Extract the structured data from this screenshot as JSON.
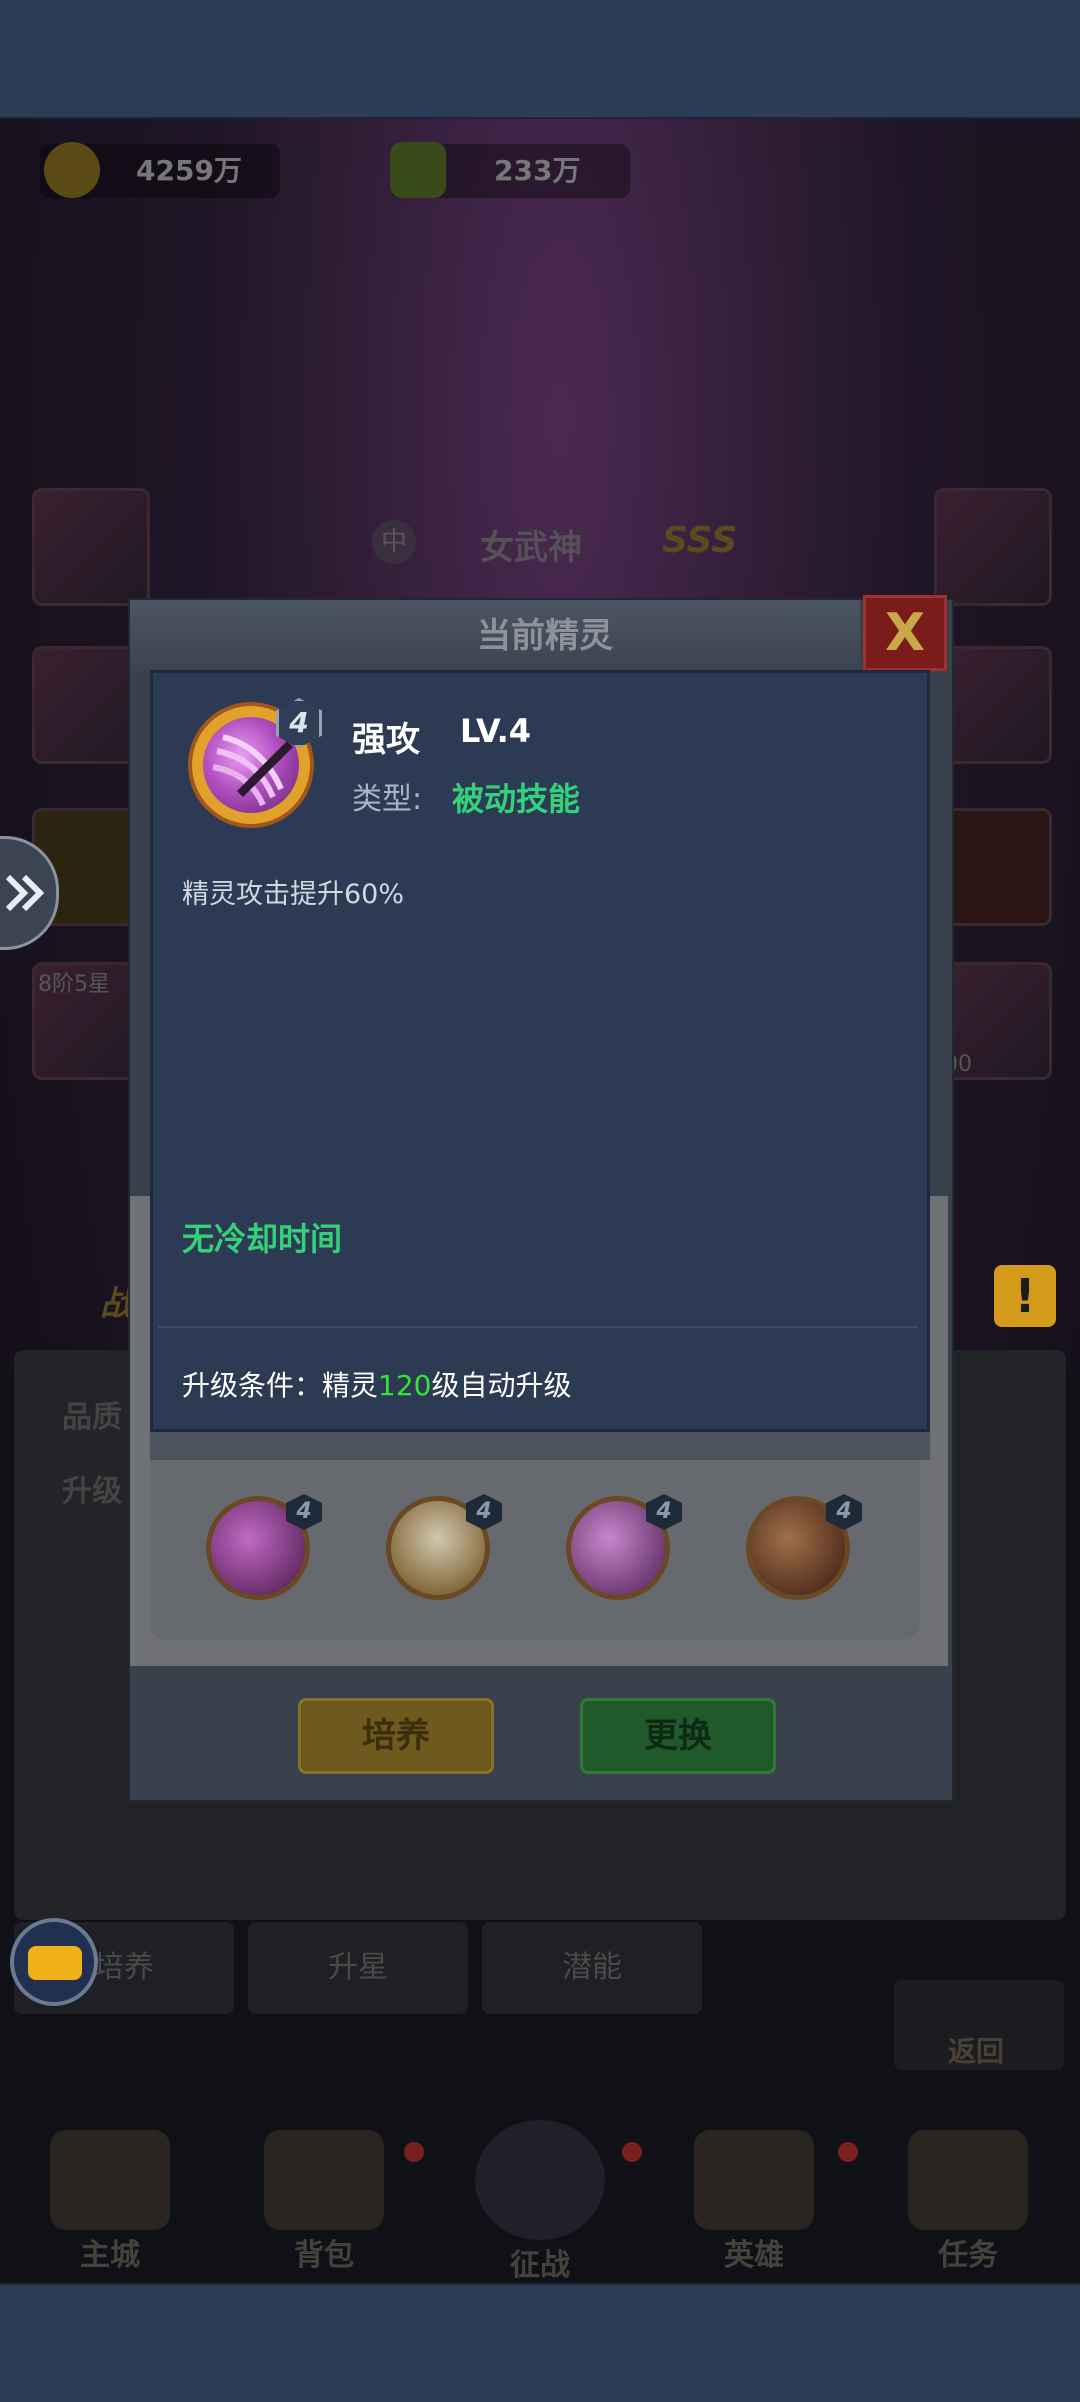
{
  "colors": {
    "accent_green": "#35d07a",
    "highlight_green": "#35e23a",
    "dialog_bg": "#2c3b53",
    "close_red": "#7a1c1c"
  },
  "resources": {
    "gold": "4259万",
    "gems": "233万"
  },
  "hero": {
    "name": "女武神",
    "grade": "SSS",
    "badge_char": "中",
    "stars_label": "8阶5星",
    "level_partial": "00"
  },
  "side_panel": {
    "label_1": "战",
    "row_1": "品质",
    "row_2": "升级"
  },
  "bottom_tabs": [
    "培养",
    "升星",
    "潜能"
  ],
  "return_label": "返回",
  "nav": [
    "主城",
    "背包",
    "征战",
    "英雄",
    "任务"
  ],
  "dialog": {
    "title": "当前精灵",
    "close_label": "X",
    "skill_icon": "sword-slash-icon",
    "skill_level_badge": "4",
    "skill_name": "强攻",
    "skill_level": "LV.4",
    "type_label": "类型:",
    "type_value": "被动技能",
    "description": "精灵攻击提升60%",
    "cooldown": "无冷却时间",
    "condition_prefix": "升级条件：精灵",
    "condition_level": "120",
    "condition_suffix": "级自动升级",
    "spirit_skills": [
      {
        "icon": "purple-orb-icon",
        "level": "4"
      },
      {
        "icon": "golden-burst-icon",
        "level": "4"
      },
      {
        "icon": "sword-slash-icon",
        "level": "4"
      },
      {
        "icon": "crescent-blade-icon",
        "level": "4"
      }
    ],
    "train_button": "培养",
    "replace_button": "更换"
  }
}
